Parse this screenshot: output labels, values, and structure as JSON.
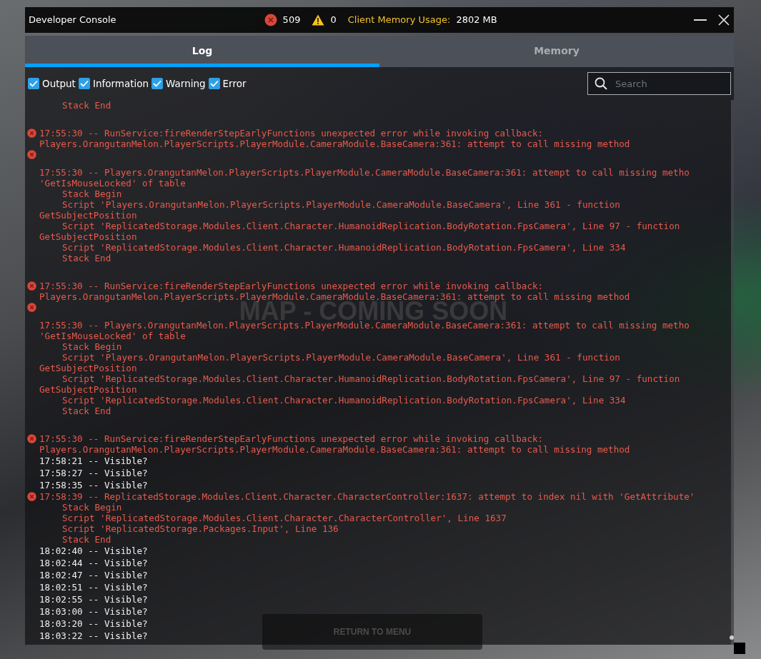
{
  "window": {
    "title": "Developer Console",
    "error_count": "509",
    "warning_count": "0",
    "memory_label": "Client Memory Usage:",
    "memory_value": "2802 MB"
  },
  "tabs": [
    {
      "label": "Log",
      "selected": true
    },
    {
      "label": "Memory",
      "selected": false
    }
  ],
  "filters": [
    {
      "label": "Output",
      "checked": true
    },
    {
      "label": "Information",
      "checked": true
    },
    {
      "label": "Warning",
      "checked": true
    },
    {
      "label": "Error",
      "checked": true
    }
  ],
  "search": {
    "placeholder": "Search"
  },
  "log": [
    {
      "kind": "tail",
      "lines": [
        {
          "kind": "stack",
          "text": "Stack End"
        }
      ]
    },
    {
      "kind": "error",
      "lines": [
        {
          "kind": "head",
          "text": "17:55:30 -- RunService:fireRenderStepEarlyFunctions unexpected error while invoking callback:"
        },
        {
          "kind": "wrap",
          "text": "Players.OrangutanMelon.PlayerScripts.PlayerModule.CameraModule.BaseCamera:361: attempt to call missing method"
        }
      ]
    },
    {
      "kind": "marker"
    },
    {
      "kind": "detail",
      "lines": [
        {
          "kind": "head",
          "text": "17:55:30 -- Players.OrangutanMelon.PlayerScripts.PlayerModule.CameraModule.BaseCamera:361: attempt to call missing metho"
        },
        {
          "kind": "wrap",
          "text": "'GetIsMouseLocked' of table"
        },
        {
          "kind": "stack",
          "text": "Stack Begin"
        },
        {
          "kind": "stack",
          "text": "Script 'Players.OrangutanMelon.PlayerScripts.PlayerModule.CameraModule.BaseCamera', Line 361 - function"
        },
        {
          "kind": "wrap",
          "text": "GetSubjectPosition"
        },
        {
          "kind": "stack",
          "text": "Script 'ReplicatedStorage.Modules.Client.Character.HumanoidReplication.BodyRotation.FpsCamera', Line 97 - function"
        },
        {
          "kind": "wrap",
          "text": "GetSubjectPosition"
        },
        {
          "kind": "stack",
          "text": "Script 'ReplicatedStorage.Modules.Client.Character.HumanoidReplication.BodyRotation.FpsCamera', Line 334"
        },
        {
          "kind": "stack",
          "text": "Stack End"
        }
      ]
    },
    {
      "kind": "error",
      "lines": [
        {
          "kind": "head",
          "text": "17:55:30 -- RunService:fireRenderStepEarlyFunctions unexpected error while invoking callback:"
        },
        {
          "kind": "wrap",
          "text": "Players.OrangutanMelon.PlayerScripts.PlayerModule.CameraModule.BaseCamera:361: attempt to call missing method"
        }
      ]
    },
    {
      "kind": "marker"
    },
    {
      "kind": "detail",
      "lines": [
        {
          "kind": "head",
          "text": "17:55:30 -- Players.OrangutanMelon.PlayerScripts.PlayerModule.CameraModule.BaseCamera:361: attempt to call missing metho"
        },
        {
          "kind": "wrap",
          "text": "'GetIsMouseLocked' of table"
        },
        {
          "kind": "stack",
          "text": "Stack Begin"
        },
        {
          "kind": "stack",
          "text": "Script 'Players.OrangutanMelon.PlayerScripts.PlayerModule.CameraModule.BaseCamera', Line 361 - function"
        },
        {
          "kind": "wrap",
          "text": "GetSubjectPosition"
        },
        {
          "kind": "stack",
          "text": "Script 'ReplicatedStorage.Modules.Client.Character.HumanoidReplication.BodyRotation.FpsCamera', Line 97 - function"
        },
        {
          "kind": "wrap",
          "text": "GetSubjectPosition"
        },
        {
          "kind": "stack",
          "text": "Script 'ReplicatedStorage.Modules.Client.Character.HumanoidReplication.BodyRotation.FpsCamera', Line 334"
        },
        {
          "kind": "stack",
          "text": "Stack End"
        }
      ]
    },
    {
      "kind": "error",
      "lines": [
        {
          "kind": "head",
          "text": "17:55:30 -- RunService:fireRenderStepEarlyFunctions unexpected error while invoking callback:"
        },
        {
          "kind": "wrap",
          "text": "Players.OrangutanMelon.PlayerScripts.PlayerModule.CameraModule.BaseCamera:361: attempt to call missing method"
        }
      ]
    },
    {
      "kind": "output",
      "lines": [
        {
          "kind": "head",
          "text": "17:58:21 -- Visible?"
        }
      ]
    },
    {
      "kind": "output",
      "lines": [
        {
          "kind": "head",
          "text": "17:58:27 -- Visible?"
        }
      ]
    },
    {
      "kind": "output",
      "lines": [
        {
          "kind": "head",
          "text": "17:58:35 -- Visible?"
        }
      ]
    },
    {
      "kind": "error_inline",
      "lines": [
        {
          "kind": "head",
          "text": "17:58:39 -- ReplicatedStorage.Modules.Client.Character.CharacterController:1637: attempt to index nil with 'GetAttribute'"
        },
        {
          "kind": "stack",
          "text": "Stack Begin"
        },
        {
          "kind": "stack",
          "text": "Script 'ReplicatedStorage.Modules.Client.Character.CharacterController', Line 1637"
        },
        {
          "kind": "stack",
          "text": "Script 'ReplicatedStorage.Packages.Input', Line 136"
        },
        {
          "kind": "stack",
          "text": "Stack End"
        }
      ]
    },
    {
      "kind": "output",
      "lines": [
        {
          "kind": "head",
          "text": "18:02:40 -- Visible?"
        }
      ]
    },
    {
      "kind": "output",
      "lines": [
        {
          "kind": "head",
          "text": "18:02:44 -- Visible?"
        }
      ]
    },
    {
      "kind": "output",
      "lines": [
        {
          "kind": "head",
          "text": "18:02:47 -- Visible?"
        }
      ]
    },
    {
      "kind": "output",
      "lines": [
        {
          "kind": "head",
          "text": "18:02:51 -- Visible?"
        }
      ]
    },
    {
      "kind": "output",
      "lines": [
        {
          "kind": "head",
          "text": "18:02:55 -- Visible?"
        }
      ]
    },
    {
      "kind": "output",
      "lines": [
        {
          "kind": "head",
          "text": "18:03:00 -- Visible?"
        }
      ]
    },
    {
      "kind": "output",
      "lines": [
        {
          "kind": "head",
          "text": "18:03:20 -- Visible?"
        }
      ]
    },
    {
      "kind": "output",
      "lines": [
        {
          "kind": "head",
          "text": "18:03:22 -- Visible?"
        }
      ]
    }
  ],
  "game": {
    "map_label": "MAP - COMING SOON",
    "return_button": "RETURN TO MENU"
  }
}
